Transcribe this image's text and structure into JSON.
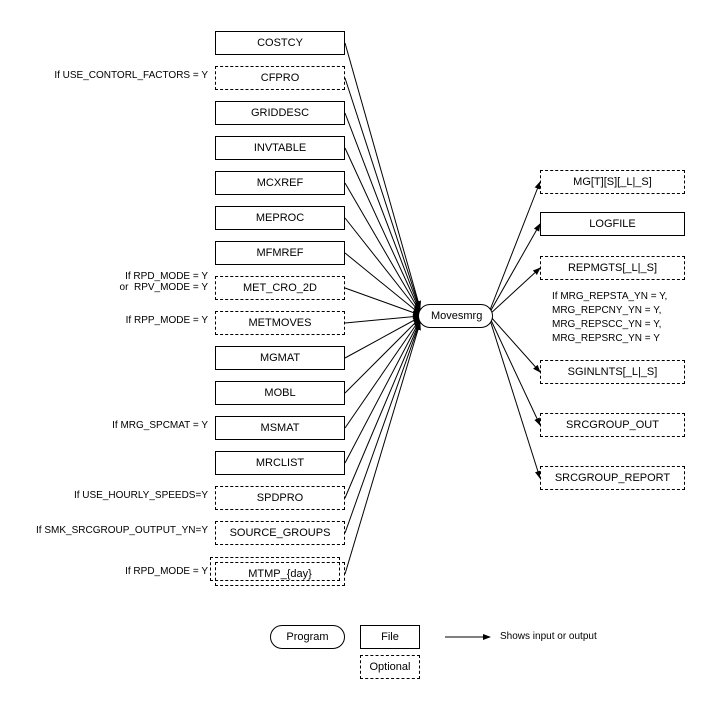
{
  "diagram": {
    "center_program": "Movesmrg",
    "inputs": [
      {
        "label": "COSTCY",
        "optional": false,
        "condition": null
      },
      {
        "label": "CFPRO",
        "optional": true,
        "condition": "If USE_CONTORL_FACTORS = Y"
      },
      {
        "label": "GRIDDESC",
        "optional": false,
        "condition": null
      },
      {
        "label": "INVTABLE",
        "optional": false,
        "condition": null
      },
      {
        "label": "MCXREF",
        "optional": false,
        "condition": null
      },
      {
        "label": "MEPROC",
        "optional": false,
        "condition": null
      },
      {
        "label": "MFMREF",
        "optional": false,
        "condition": null
      },
      {
        "label": "MET_CRO_2D",
        "optional": true,
        "condition": "If RPD_MODE = Y\nor  RPV_MODE = Y"
      },
      {
        "label": "METMOVES",
        "optional": true,
        "condition": "If RPP_MODE = Y"
      },
      {
        "label": "MGMAT",
        "optional": false,
        "condition": null
      },
      {
        "label": "MOBL",
        "optional": false,
        "condition": null
      },
      {
        "label": "MSMAT",
        "optional": false,
        "condition": "If MRG_SPCMAT = Y"
      },
      {
        "label": "MRCLIST",
        "optional": false,
        "condition": null
      },
      {
        "label": "SPDPRO",
        "optional": true,
        "condition": "If USE_HOURLY_SPEEDS=Y"
      },
      {
        "label": "SOURCE_GROUPS",
        "optional": true,
        "condition": "If SMK_SRCGROUP_OUTPUT_YN=Y"
      },
      {
        "label": "MTMP_{day}",
        "optional": true,
        "condition": "If RPD_MODE = Y",
        "stack": true
      }
    ],
    "outputs": [
      {
        "label": "MG[T][S][_L|_S]",
        "optional": true,
        "condition": null
      },
      {
        "label": "LOGFILE",
        "optional": false,
        "condition": null
      },
      {
        "label": "REPMGTS[_L|_S]",
        "optional": true,
        "condition": null
      },
      {
        "label": "SGINLNTS[_L|_S]",
        "optional": true,
        "condition": "If MRG_REPSTA_YN = Y,\nMRG_REPCNY_YN = Y,\nMRG_REPSCC_YN = Y,\nMRG_REPSRC_YN = Y"
      },
      {
        "label": "SRCGROUP_OUT",
        "optional": true,
        "condition": null
      },
      {
        "label": "SRCGROUP_REPORT",
        "optional": true,
        "condition": null
      }
    ],
    "legend": {
      "program": "Program",
      "file": "File",
      "optional": "Optional",
      "arrow": "Shows input or output"
    }
  }
}
